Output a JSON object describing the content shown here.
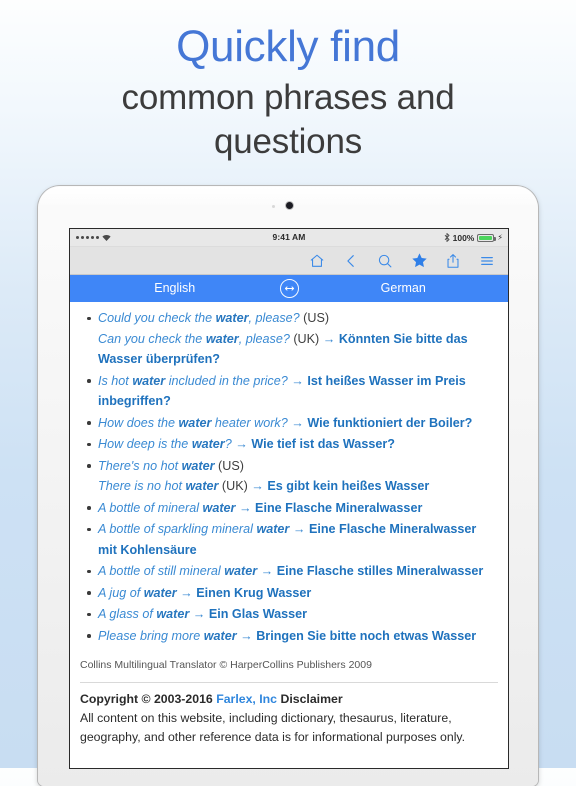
{
  "headline": {
    "line1": "Quickly find",
    "line2": "common phrases and",
    "line3": "questions",
    "accent_color": "#4577d6",
    "text_color": "#3c3c3c"
  },
  "device": {
    "statusbar": {
      "signal_icon": "signal-dots",
      "wifi_icon": "wifi-icon",
      "time": "9:41 AM",
      "bluetooth_icon": "bluetooth-icon",
      "battery_percent": "100%",
      "battery_icon": "battery-full-icon",
      "charging_icon": "lightning-bolt-icon"
    },
    "toolbar": {
      "items": [
        {
          "name": "home-icon",
          "label": "Home"
        },
        {
          "name": "back-chevron-icon",
          "label": "Back"
        },
        {
          "name": "search-icon",
          "label": "Search"
        },
        {
          "name": "star-filled-icon",
          "label": "Favorites"
        },
        {
          "name": "share-icon",
          "label": "Share"
        },
        {
          "name": "hamburger-menu-icon",
          "label": "Menu"
        }
      ],
      "accent_color": "#3b8ae8",
      "background": "#e3e3e3"
    },
    "language_bar": {
      "source_language": "English",
      "target_language": "German",
      "swap_icon": "swap-arrows-icon",
      "background": "#3f86f7",
      "text_color": "#ffffff"
    }
  },
  "content": {
    "entries": [
      {
        "lines": [
          {
            "src": "Could you check the ",
            "src_bold": "water",
            "src_tail": ", please? ",
            "region": "(US)"
          },
          {
            "src": "Can you check the ",
            "src_bold": "water",
            "src_tail": ", please? ",
            "region": "(UK)",
            "arrow": "→",
            "target": "Könnten Sie bitte das Wasser überprüfen?"
          }
        ]
      },
      {
        "lines": [
          {
            "src": "Is hot ",
            "src_bold": "water",
            "src_tail": " included in the price?",
            "arrow": "→",
            "target": "Ist heißes Wasser im Preis inbegriffen?"
          }
        ]
      },
      {
        "lines": [
          {
            "src": "How does the ",
            "src_bold": "water",
            "src_tail": " heater work?",
            "arrow": "→",
            "target": "Wie funktioniert der Boiler?"
          }
        ]
      },
      {
        "lines": [
          {
            "src": "How deep is the ",
            "src_bold": "water",
            "src_tail": "?",
            "arrow": "→",
            "target": "Wie tief ist das Wasser?"
          }
        ]
      },
      {
        "lines": [
          {
            "src": "There's no hot ",
            "src_bold": "water",
            "src_tail": " ",
            "region": "(US)"
          },
          {
            "src": "There is no hot ",
            "src_bold": "water",
            "src_tail": " ",
            "region": "(UK)",
            "arrow": "→",
            "target": "Es gibt kein heißes Wasser"
          }
        ]
      },
      {
        "lines": [
          {
            "src": "A bottle of mineral ",
            "src_bold": "water",
            "src_tail": "",
            "arrow": "→",
            "target": "Eine Flasche Mineralwasser"
          }
        ]
      },
      {
        "lines": [
          {
            "src": "A bottle of sparkling mineral ",
            "src_bold": "water",
            "src_tail": "",
            "arrow": "→",
            "target": "Eine Flasche Mineralwasser mit Kohlensäure"
          }
        ]
      },
      {
        "lines": [
          {
            "src": "A bottle of still mineral ",
            "src_bold": "water",
            "src_tail": "",
            "arrow": "→",
            "target": "Eine Flasche stilles Mineralwasser"
          }
        ]
      },
      {
        "lines": [
          {
            "src": "A jug of ",
            "src_bold": "water",
            "src_tail": "",
            "arrow": "→",
            "target": "Einen Krug Wasser"
          }
        ]
      },
      {
        "lines": [
          {
            "src": "A glass of ",
            "src_bold": "water",
            "src_tail": "",
            "arrow": "→",
            "target": "Ein Glas Wasser"
          }
        ]
      },
      {
        "lines": [
          {
            "src": "Please bring more ",
            "src_bold": "water",
            "src_tail": "",
            "arrow": "→",
            "target": "Bringen Sie bitte noch etwas Wasser"
          }
        ]
      }
    ],
    "attribution": "Collins Multilingual Translator © HarperCollins Publishers 2009",
    "footer": {
      "copyright_prefix": "Copyright © 2003-2016 ",
      "company_link": "Farlex, Inc",
      "disclaimer_label": " Disclaimer",
      "body": "All content on this website, including dictionary, thesaurus, literature, geography, and other reference data is for informational purposes only."
    }
  }
}
